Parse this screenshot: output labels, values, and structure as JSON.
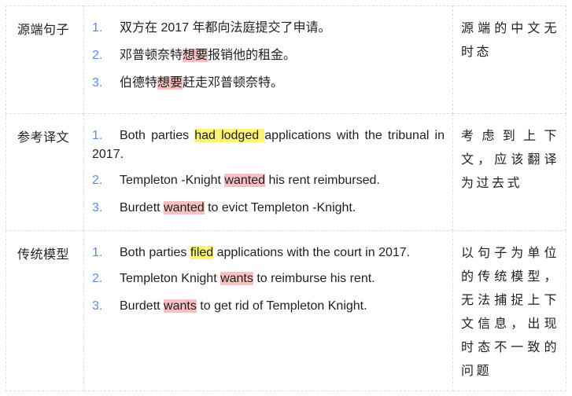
{
  "rows": [
    {
      "label": "源端句子",
      "items": [
        {
          "num": "1.",
          "pre": "双方在 2017 年都向法庭提交了申请。",
          "hl": "",
          "hl_type": "",
          "post": ""
        },
        {
          "num": "2.",
          "pre": "邓普顿奈特",
          "hl": "想要",
          "hl_type": "red",
          "post": "报销他的租金。"
        },
        {
          "num": "3.",
          "pre": "伯德特",
          "hl": "想要",
          "hl_type": "red",
          "post": "赶走邓普顿奈特。"
        }
      ],
      "note": "源端的中文无时态"
    },
    {
      "label": "参考译文",
      "items": [
        {
          "num": "1.",
          "pre": "Both parties ",
          "hl": "had lodged ",
          "hl_type": "yellow",
          "post": "applications with the tribunal in 2017."
        },
        {
          "num": "2.",
          "pre": "Templeton ‑Knight ",
          "hl": "wanted",
          "hl_type": "red",
          "post": " his rent reimbursed."
        },
        {
          "num": "3.",
          "pre": "Burdett ",
          "hl": "wanted",
          "hl_type": "red",
          "post": " to evict Templeton ‑Knight."
        }
      ],
      "note": "考虑到上下文，应该翻译为过去式"
    },
    {
      "label": "传统模型",
      "items": [
        {
          "num": "1.",
          "pre": "Both parties ",
          "hl": "filed",
          "hl_type": "yellow",
          "post": " applications with the court in 2017."
        },
        {
          "num": "2.",
          "pre": "Templeton Knight ",
          "hl": "wants",
          "hl_type": "red",
          "post": " to reimburse his rent."
        },
        {
          "num": "3.",
          "pre": "Burdett ",
          "hl": "wants",
          "hl_type": "red",
          "post": " to get rid of Templeton Knight."
        }
      ],
      "note": "以句子为单位的传统模型，无法捕捉上下文信息，出现时态不一致的问题"
    }
  ],
  "colors": {
    "number": "#5b8def",
    "highlight_yellow": "#fdf477",
    "highlight_red": "#f8c0c0",
    "border": "#dcdfe6"
  }
}
